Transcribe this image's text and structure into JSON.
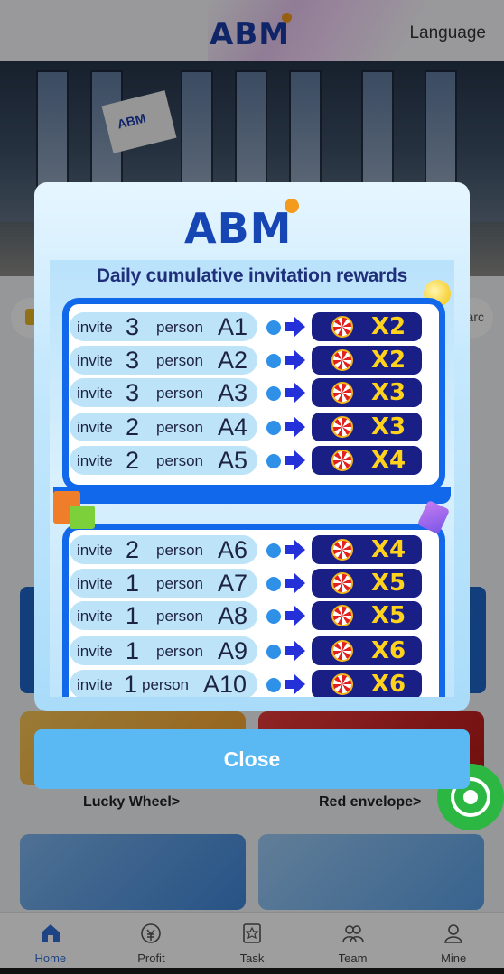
{
  "header": {
    "logo_text": "ABM",
    "language_label": "Language"
  },
  "hero": {
    "flag_text": "ABM"
  },
  "notice": {
    "text": "arc"
  },
  "cards": [
    {
      "label": "Lucky Wheel>"
    },
    {
      "label": "Red envelope>"
    }
  ],
  "tabbar": {
    "tabs": [
      {
        "label": "Home",
        "icon": "home-icon"
      },
      {
        "label": "Profit",
        "icon": "profit-icon"
      },
      {
        "label": "Task",
        "icon": "task-icon"
      },
      {
        "label": "Team",
        "icon": "team-icon"
      },
      {
        "label": "Mine",
        "icon": "user-icon"
      }
    ],
    "active": "Home"
  },
  "modal": {
    "logo_text": "ABM",
    "title": "Daily cumulative invitation rewards",
    "close_label": "Close",
    "rows": [
      {
        "word1": "invite",
        "count": "3",
        "word2": "person",
        "code": "A1",
        "multiplier": "X2"
      },
      {
        "word1": "invite",
        "count": "3",
        "word2": "person",
        "code": "A2",
        "multiplier": "X2"
      },
      {
        "word1": "invite",
        "count": "3",
        "word2": "person",
        "code": "A3",
        "multiplier": "X3"
      },
      {
        "word1": "invite",
        "count": "2",
        "word2": "person",
        "code": "A4",
        "multiplier": "X3"
      },
      {
        "word1": "invite",
        "count": "2",
        "word2": "person",
        "code": "A5",
        "multiplier": "X4"
      },
      {
        "word1": "invite",
        "count": "2",
        "word2": "person",
        "code": "A6",
        "multiplier": "X4"
      },
      {
        "word1": "invite",
        "count": "1",
        "word2": "person",
        "code": "A7",
        "multiplier": "X5"
      },
      {
        "word1": "invite",
        "count": "1",
        "word2": "person",
        "code": "A8",
        "multiplier": "X5"
      },
      {
        "word1": "invite",
        "count": "1",
        "word2": "person",
        "code": "A9",
        "multiplier": "X6"
      },
      {
        "word1": "invite",
        "count": "1",
        "word2": "person",
        "code": "A10",
        "multiplier": "X6"
      }
    ]
  },
  "colors": {
    "brand_blue": "#1646b4",
    "logo_dot": "#f49a1d",
    "panel_blue": "#1268ea",
    "prize_bg": "#1a1f86",
    "multiplier": "#ffd21b",
    "close_button": "#5ab9f2",
    "whatsapp": "#2bb741",
    "tab_active": "#2f6fd6"
  }
}
